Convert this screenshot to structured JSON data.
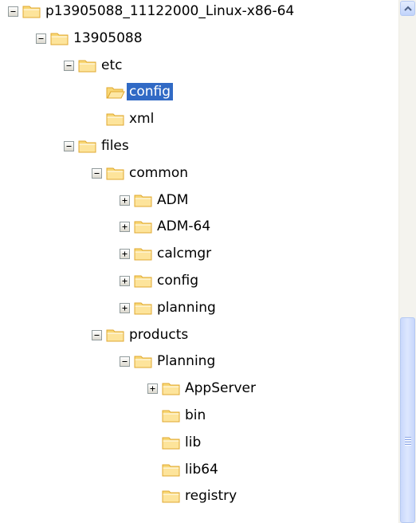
{
  "tree": [
    {
      "label": "p13905088_11122000_Linux-x86-64",
      "level": 0,
      "expander": "minus",
      "selected": false
    },
    {
      "label": "13905088",
      "level": 1,
      "expander": "minus",
      "selected": false
    },
    {
      "label": "etc",
      "level": 2,
      "expander": "minus",
      "selected": false
    },
    {
      "label": "config",
      "level": 3,
      "expander": "none",
      "selected": true,
      "open": true
    },
    {
      "label": "xml",
      "level": 3,
      "expander": "none",
      "selected": false
    },
    {
      "label": "files",
      "level": 2,
      "expander": "minus",
      "selected": false
    },
    {
      "label": "common",
      "level": 3,
      "expander": "minus",
      "selected": false
    },
    {
      "label": "ADM",
      "level": 4,
      "expander": "plus",
      "selected": false
    },
    {
      "label": "ADM-64",
      "level": 4,
      "expander": "plus",
      "selected": false
    },
    {
      "label": "calcmgr",
      "level": 4,
      "expander": "plus",
      "selected": false
    },
    {
      "label": "config",
      "level": 4,
      "expander": "plus",
      "selected": false
    },
    {
      "label": "planning",
      "level": 4,
      "expander": "plus",
      "selected": false
    },
    {
      "label": "products",
      "level": 3,
      "expander": "minus",
      "selected": false
    },
    {
      "label": "Planning",
      "level": 4,
      "expander": "minus",
      "selected": false
    },
    {
      "label": "AppServer",
      "level": 5,
      "expander": "plus",
      "selected": false
    },
    {
      "label": "bin",
      "level": 5,
      "expander": "none",
      "selected": false
    },
    {
      "label": "lib",
      "level": 5,
      "expander": "none",
      "selected": false
    },
    {
      "label": "lib64",
      "level": 5,
      "expander": "none",
      "selected": false
    },
    {
      "label": "registry",
      "level": 5,
      "expander": "none",
      "selected": false
    }
  ],
  "colors": {
    "selection_bg": "#316ac5",
    "selection_text": "#ffffff",
    "folder_fill": "#f8d775",
    "folder_dark": "#e0a830"
  },
  "scrollbar": {
    "position_fraction": 0.61
  }
}
